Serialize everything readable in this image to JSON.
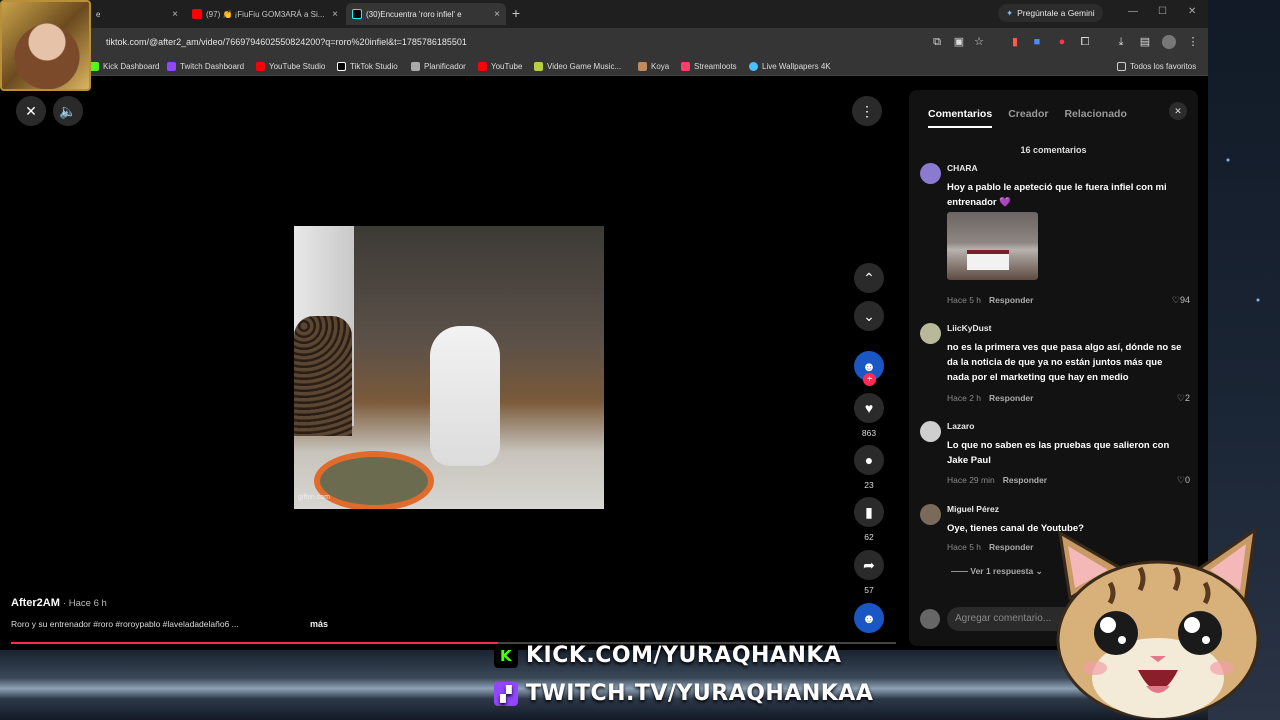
{
  "browser": {
    "tabs": [
      {
        "label": "e",
        "close": "×"
      },
      {
        "label": "(97) 👏 ¡FiuFiu GOM3ARÁ a Si...",
        "close": "×"
      },
      {
        "label": "(30)Encuentra 'roro infiel' e",
        "close": "×"
      }
    ],
    "new_tab": "+",
    "gemini_label": "Pregúntale a Gemini",
    "url": "tiktok.com/@after2_am/video/7669794602550824200?q=roro%20infiel&t=1785786185501",
    "bookmarks": [
      "Kick Dashboard",
      "Twitch Dashboard",
      "YouTube Studio",
      "TikTok Studio",
      "Planificador",
      "YouTube",
      "Video Game Music...",
      "Koya",
      "Streamloots",
      "Live Wallpapers 4K"
    ],
    "all_bookmarks": "Todos los favoritos"
  },
  "video": {
    "watermark": "gifbin.com",
    "author": "After2AM",
    "time": "· Hace 6 h",
    "description": "Roro y su entrenador #roro #roroypablo #laveladadelaño6 ...",
    "more": "más",
    "progress": 0.55
  },
  "actions": {
    "likes": "863",
    "comments": "23",
    "saves": "62",
    "shares": "57"
  },
  "panel": {
    "tabs": [
      "Comentarios",
      "Creador",
      "Relacionado"
    ],
    "count_label": "16 comentarios",
    "comments": [
      {
        "user": "CHARA",
        "text": "Hoy a pablo le apeteció que le fuera infiel con mi entrenador 💜",
        "time": "Hace 5 h",
        "reply": "Responder",
        "likes": "94"
      },
      {
        "user": "LiicKyDust",
        "text": "no es la primera ves que pasa algo así, dónde no se da la noticia de que ya no están juntos más que nada por el marketing que hay en medio",
        "time": "Hace 2 h",
        "reply": "Responder",
        "likes": "2"
      },
      {
        "user": "Lazaro",
        "text": "Lo que no saben es las pruebas que salieron con Jake Paul",
        "time": "Hace 29 min",
        "reply": "Responder",
        "likes": "0"
      },
      {
        "user": "Miguel Pérez",
        "text": "Oye, tienes canal de Youtube?",
        "time": "Hace 5 h",
        "reply": "Responder",
        "likes": ""
      }
    ],
    "view_replies": "Ver 1 respuesta",
    "add_placeholder": "Agregar comentario..."
  },
  "overlay": {
    "kick": "KICK.COM/YURAQHANKA",
    "twitch": "TWITCH.TV/YURAQHANKAA"
  }
}
